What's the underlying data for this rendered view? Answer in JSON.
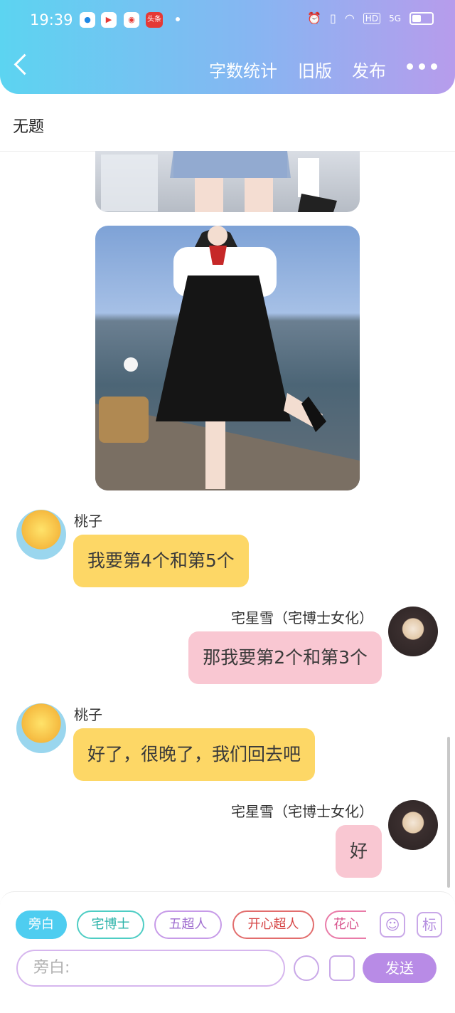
{
  "status_bar": {
    "time": "19:39",
    "app_icons": [
      "tencent-video-icon",
      "youtube-play-icon",
      "weibo-icon",
      "toutiao-icon"
    ],
    "toutiao_label": "头条",
    "network_hd": "HD",
    "network_5g": "5G"
  },
  "header": {
    "word_count": "字数统计",
    "old_version": "旧版",
    "publish": "发布"
  },
  "title": "无题",
  "messages": [
    {
      "sender": "桃子",
      "text": "我要第4个和第5个",
      "side": "left"
    },
    {
      "sender": "宅星雪（宅博士女化）",
      "text": "那我要第2个和第3个",
      "side": "right"
    },
    {
      "sender": "桃子",
      "text": "好了，很晚了，我们回去吧",
      "side": "left"
    },
    {
      "sender": "宅星雪（宅博士女化）",
      "text": "好",
      "side": "right"
    }
  ],
  "composer": {
    "chips": [
      "旁白",
      "宅博士",
      "五超人",
      "开心超人",
      "花心"
    ],
    "tag_label": "标",
    "input_placeholder": "旁白:",
    "send": "发送"
  },
  "colors": {
    "header_start": "#5cd4f1",
    "header_end": "#b79cec",
    "yellow_bubble": "#fdd766",
    "pink_bubble": "#f9c7d2",
    "accent_purple": "#b88be6",
    "accent_cyan": "#4ecdf0"
  }
}
